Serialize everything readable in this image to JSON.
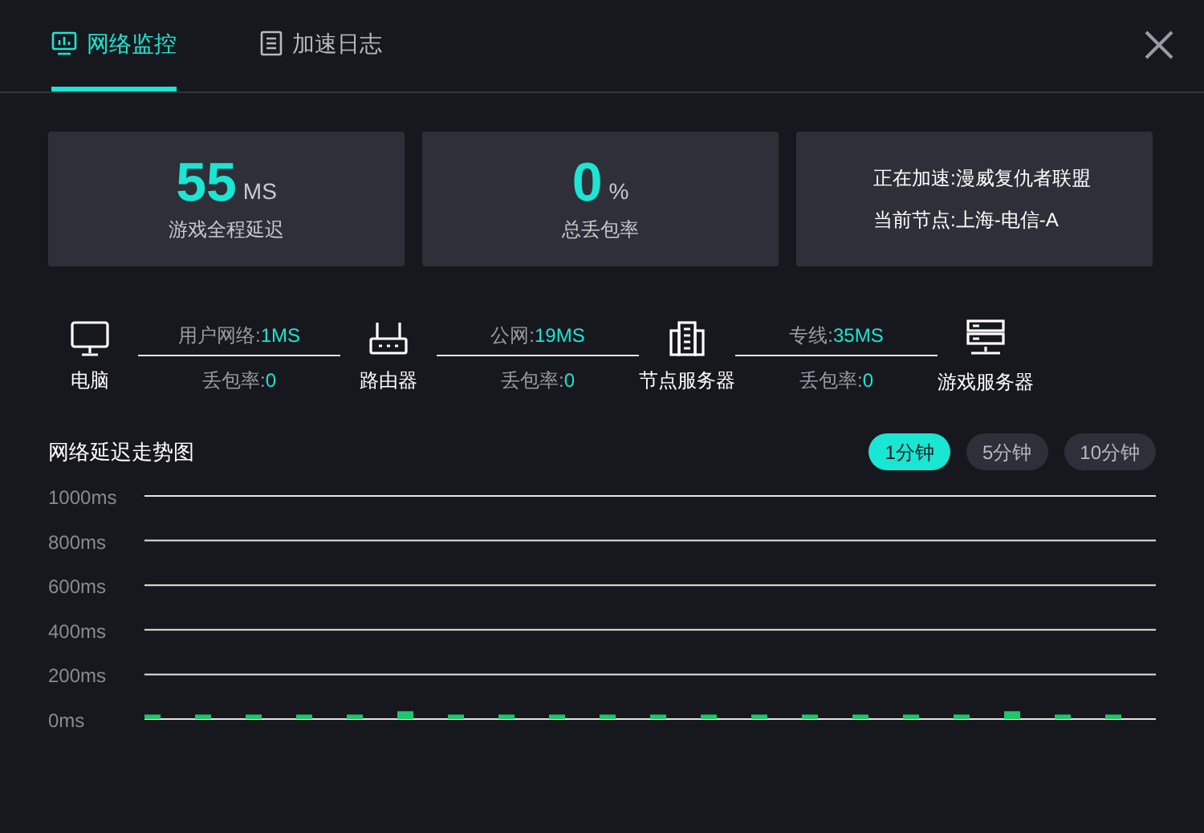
{
  "tabs": [
    {
      "label": "网络监控",
      "kind": "monitor",
      "selected": true
    },
    {
      "label": "加速日志",
      "kind": "log",
      "selected": false
    }
  ],
  "stats": [
    {
      "kind": "metric",
      "value": "55",
      "unit": "MS",
      "label": "游戏全程延迟"
    },
    {
      "kind": "metric",
      "value": "0",
      "unit": "%",
      "label": "总丢包率"
    },
    {
      "kind": "info",
      "lines": [
        "正在加速:漫威复仇者联盟",
        "当前节点:上海-电信-A"
      ]
    }
  ],
  "route": {
    "nodes": [
      {
        "kind": "pc",
        "label": "电脑"
      },
      {
        "kind": "router",
        "label": "路由器"
      },
      {
        "kind": "node_server",
        "label": "节点服务器"
      },
      {
        "kind": "game_server",
        "label": "游戏服务器"
      }
    ],
    "links": [
      {
        "latency_label": "用户网络:",
        "latency": "1MS",
        "loss_label": "丢包率:",
        "loss": "0"
      },
      {
        "latency_label": "公网:",
        "latency": "19MS",
        "loss_label": "丢包率:",
        "loss": "0"
      },
      {
        "latency_label": "专线:",
        "latency": "35MS",
        "loss_label": "丢包率:",
        "loss": "0"
      }
    ]
  },
  "trend": {
    "title": "网络延迟走势图",
    "ranges": [
      {
        "label": "1分钟",
        "selected": true
      },
      {
        "label": "5分钟",
        "selected": false
      },
      {
        "label": "10分钟",
        "selected": false
      }
    ],
    "chart_data": {
      "type": "bar",
      "grid": true,
      "series": [
        {
          "color": "#1ec76b",
          "values": [
            20,
            20,
            20,
            20,
            20,
            35,
            20,
            20,
            20,
            20,
            20,
            20,
            20,
            20,
            20,
            20,
            20,
            35,
            20,
            20
          ]
        }
      ],
      "ylim": [
        0,
        1000
      ],
      "yticks": [
        {
          "value": 0,
          "label": "0ms"
        },
        {
          "value": 200,
          "label": "200ms"
        },
        {
          "value": 400,
          "label": "400ms"
        },
        {
          "value": 600,
          "label": "600ms"
        },
        {
          "value": 800,
          "label": "800ms"
        },
        {
          "value": 1000,
          "label": "1000ms"
        }
      ]
    }
  }
}
